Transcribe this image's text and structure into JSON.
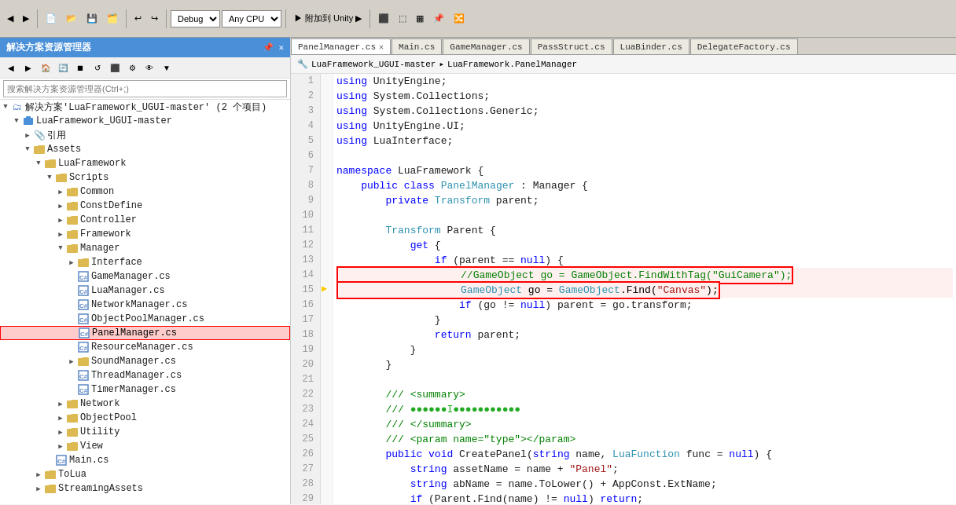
{
  "toolbar": {
    "debug_label": "Debug",
    "cpu_label": "Any CPU",
    "attach_label": "附加到 Unity ▶",
    "title": "解决方案资源管理器"
  },
  "tabs": [
    {
      "label": "PanelManager.cs",
      "active": true,
      "closable": true
    },
    {
      "label": "Main.cs",
      "active": false,
      "closable": false
    },
    {
      "label": "GameManager.cs",
      "active": false,
      "closable": false
    },
    {
      "label": "PassStruct.cs",
      "active": false,
      "closable": false
    },
    {
      "label": "LuaBinder.cs",
      "active": false,
      "closable": false
    },
    {
      "label": "DelegateFactory.cs",
      "active": false,
      "closable": false
    }
  ],
  "breadcrumb": {
    "project": "LuaFramework_UGUI-master",
    "class": "LuaFramework.PanelManager"
  },
  "tree": {
    "items": [
      {
        "id": "solution",
        "label": "解决方案'LuaFramework_UGUI-master' (2 个项目)",
        "indent": 0,
        "type": "solution",
        "expanded": true,
        "arrow": "▼"
      },
      {
        "id": "project",
        "label": "LuaFramework_UGUI-master",
        "indent": 1,
        "type": "project",
        "expanded": true,
        "arrow": "▼"
      },
      {
        "id": "ref",
        "label": "引用",
        "indent": 2,
        "type": "ref",
        "expanded": false,
        "arrow": "▶"
      },
      {
        "id": "assets",
        "label": "Assets",
        "indent": 2,
        "type": "folder",
        "expanded": true,
        "arrow": "▼"
      },
      {
        "id": "luaframework",
        "label": "LuaFramework",
        "indent": 3,
        "type": "folder",
        "expanded": true,
        "arrow": "▼"
      },
      {
        "id": "scripts",
        "label": "Scripts",
        "indent": 4,
        "type": "folder",
        "expanded": true,
        "arrow": "▼"
      },
      {
        "id": "common",
        "label": "Common",
        "indent": 5,
        "type": "folder",
        "expanded": false,
        "arrow": "▶"
      },
      {
        "id": "constdefine",
        "label": "ConstDefine",
        "indent": 5,
        "type": "folder",
        "expanded": false,
        "arrow": "▶"
      },
      {
        "id": "controller",
        "label": "Controller",
        "indent": 5,
        "type": "folder",
        "expanded": false,
        "arrow": "▶"
      },
      {
        "id": "framework",
        "label": "Framework",
        "indent": 5,
        "type": "folder",
        "expanded": false,
        "arrow": "▶"
      },
      {
        "id": "manager",
        "label": "Manager",
        "indent": 5,
        "type": "folder",
        "expanded": true,
        "arrow": "▼"
      },
      {
        "id": "interface",
        "label": "Interface",
        "indent": 6,
        "type": "folder",
        "expanded": false,
        "arrow": "▶"
      },
      {
        "id": "gamemanager",
        "label": "GameManager.cs",
        "indent": 6,
        "type": "cs"
      },
      {
        "id": "luamanager",
        "label": "LuaManager.cs",
        "indent": 6,
        "type": "cs"
      },
      {
        "id": "networkmanager",
        "label": "NetworkManager.cs",
        "indent": 6,
        "type": "cs"
      },
      {
        "id": "objectpoolmanager",
        "label": "ObjectPoolManager.cs",
        "indent": 6,
        "type": "cs"
      },
      {
        "id": "panelmanager",
        "label": "PanelManager.cs",
        "indent": 6,
        "type": "cs",
        "selected": true,
        "highlighted": true
      },
      {
        "id": "resourcemanager",
        "label": "ResourceManager.cs",
        "indent": 6,
        "type": "cs"
      },
      {
        "id": "soundmanager",
        "label": "SoundManager.cs",
        "indent": 6,
        "type": "folder",
        "expanded": false,
        "arrow": "▶"
      },
      {
        "id": "threadmanager",
        "label": "ThreadManager.cs",
        "indent": 6,
        "type": "cs"
      },
      {
        "id": "timermanager",
        "label": "TimerManager.cs",
        "indent": 6,
        "type": "cs"
      },
      {
        "id": "network",
        "label": "Network",
        "indent": 5,
        "type": "folder",
        "expanded": false,
        "arrow": "▶"
      },
      {
        "id": "objectpool",
        "label": "ObjectPool",
        "indent": 5,
        "type": "folder",
        "expanded": false,
        "arrow": "▶"
      },
      {
        "id": "utility",
        "label": "Utility",
        "indent": 5,
        "type": "folder",
        "expanded": false,
        "arrow": "▶"
      },
      {
        "id": "view",
        "label": "View",
        "indent": 5,
        "type": "folder",
        "expanded": false,
        "arrow": "▶"
      },
      {
        "id": "maincs",
        "label": "Main.cs",
        "indent": 4,
        "type": "cs"
      },
      {
        "id": "tolua",
        "label": "ToLua",
        "indent": 3,
        "type": "folder",
        "expanded": false,
        "arrow": "▶"
      },
      {
        "id": "streamingassets",
        "label": "StreamingAssets",
        "indent": 3,
        "type": "folder",
        "expanded": false,
        "arrow": "▶"
      }
    ]
  },
  "code": {
    "lines": [
      {
        "n": 1,
        "tokens": [
          {
            "t": "kw",
            "v": "using"
          },
          {
            "t": "plain",
            "v": " UnityEngine;"
          }
        ]
      },
      {
        "n": 2,
        "tokens": [
          {
            "t": "kw",
            "v": "using"
          },
          {
            "t": "plain",
            "v": " System.Collections;"
          }
        ]
      },
      {
        "n": 3,
        "tokens": [
          {
            "t": "kw",
            "v": "using"
          },
          {
            "t": "plain",
            "v": " System.Collections.Generic;"
          }
        ]
      },
      {
        "n": 4,
        "tokens": [
          {
            "t": "kw",
            "v": "using"
          },
          {
            "t": "plain",
            "v": " UnityEngine.UI;"
          }
        ]
      },
      {
        "n": 5,
        "tokens": [
          {
            "t": "kw",
            "v": "using"
          },
          {
            "t": "plain",
            "v": " LuaInterface;"
          }
        ]
      },
      {
        "n": 6,
        "tokens": []
      },
      {
        "n": 7,
        "tokens": [
          {
            "t": "kw",
            "v": "namespace"
          },
          {
            "t": "plain",
            "v": " LuaFramework {"
          }
        ]
      },
      {
        "n": 8,
        "tokens": [
          {
            "t": "plain",
            "v": "    "
          },
          {
            "t": "kw",
            "v": "public"
          },
          {
            "t": "plain",
            "v": " "
          },
          {
            "t": "kw",
            "v": "class"
          },
          {
            "t": "plain",
            "v": " "
          },
          {
            "t": "type",
            "v": "PanelManager"
          },
          {
            "t": "plain",
            "v": " : Manager {"
          }
        ]
      },
      {
        "n": 9,
        "tokens": [
          {
            "t": "plain",
            "v": "        "
          },
          {
            "t": "kw",
            "v": "private"
          },
          {
            "t": "plain",
            "v": " "
          },
          {
            "t": "type",
            "v": "Transform"
          },
          {
            "t": "plain",
            "v": " parent;"
          }
        ]
      },
      {
        "n": 10,
        "tokens": []
      },
      {
        "n": 11,
        "tokens": [
          {
            "t": "plain",
            "v": "        "
          },
          {
            "t": "type",
            "v": "Transform"
          },
          {
            "t": "plain",
            "v": " Parent {"
          }
        ]
      },
      {
        "n": 12,
        "tokens": [
          {
            "t": "plain",
            "v": "            "
          },
          {
            "t": "kw",
            "v": "get"
          },
          {
            "t": "plain",
            "v": " {"
          }
        ]
      },
      {
        "n": 13,
        "tokens": [
          {
            "t": "plain",
            "v": "                "
          },
          {
            "t": "kw",
            "v": "if"
          },
          {
            "t": "plain",
            "v": " (parent == "
          },
          {
            "t": "kw",
            "v": "null"
          },
          {
            "t": "plain",
            "v": ") {"
          }
        ]
      },
      {
        "n": 14,
        "tokens": [
          {
            "t": "comment",
            "v": "                    //GameObject go = GameObject.FindWithTag(\"GuiCamera\");"
          }
        ],
        "redbox": true
      },
      {
        "n": 15,
        "tokens": [
          {
            "t": "plain",
            "v": "                    "
          },
          {
            "t": "type",
            "v": "GameObject"
          },
          {
            "t": "plain",
            "v": " go = "
          },
          {
            "t": "type",
            "v": "GameObject"
          },
          {
            "t": "plain",
            "v": ".Find("
          },
          {
            "t": "string",
            "v": "\"Canvas\""
          },
          {
            "t": "plain",
            "v": ");"
          },
          {
            "t": "plain",
            "v": ""
          }
        ],
        "redbox": true,
        "execpointer": true
      },
      {
        "n": 16,
        "tokens": [
          {
            "t": "plain",
            "v": "                    "
          },
          {
            "t": "kw",
            "v": "if"
          },
          {
            "t": "plain",
            "v": " (go != "
          },
          {
            "t": "kw",
            "v": "null"
          },
          {
            "t": "plain",
            "v": ") parent = go.transform;"
          }
        ]
      },
      {
        "n": 17,
        "tokens": [
          {
            "t": "plain",
            "v": "                }"
          }
        ]
      },
      {
        "n": 18,
        "tokens": [
          {
            "t": "plain",
            "v": "                "
          },
          {
            "t": "kw",
            "v": "return"
          },
          {
            "t": "plain",
            "v": " parent;"
          }
        ]
      },
      {
        "n": 19,
        "tokens": [
          {
            "t": "plain",
            "v": "            }"
          }
        ]
      },
      {
        "n": 20,
        "tokens": [
          {
            "t": "plain",
            "v": "        }"
          }
        ]
      },
      {
        "n": 21,
        "tokens": []
      },
      {
        "n": 22,
        "tokens": [
          {
            "t": "plain",
            "v": "        "
          },
          {
            "t": "comment",
            "v": "/// <summary>"
          }
        ]
      },
      {
        "n": 23,
        "tokens": [
          {
            "t": "plain",
            "v": "        "
          },
          {
            "t": "comment",
            "v": "/// "
          },
          {
            "t": "green-dots",
            "v": "●●●●●●I●●●●●●●●●●●"
          }
        ]
      },
      {
        "n": 24,
        "tokens": [
          {
            "t": "plain",
            "v": "        "
          },
          {
            "t": "comment",
            "v": "/// </summary>"
          }
        ]
      },
      {
        "n": 25,
        "tokens": [
          {
            "t": "plain",
            "v": "        "
          },
          {
            "t": "comment",
            "v": "/// <param name=\"type\"></param>"
          }
        ]
      },
      {
        "n": 26,
        "tokens": [
          {
            "t": "plain",
            "v": "        "
          },
          {
            "t": "kw",
            "v": "public"
          },
          {
            "t": "plain",
            "v": " "
          },
          {
            "t": "kw",
            "v": "void"
          },
          {
            "t": "plain",
            "v": " CreatePanel("
          },
          {
            "t": "kw",
            "v": "string"
          },
          {
            "t": "plain",
            "v": " name, "
          },
          {
            "t": "type",
            "v": "LuaFunction"
          },
          {
            "t": "plain",
            "v": " func = "
          },
          {
            "t": "kw",
            "v": "null"
          },
          {
            "t": "plain",
            "v": ") {"
          }
        ]
      },
      {
        "n": 27,
        "tokens": [
          {
            "t": "plain",
            "v": "            "
          },
          {
            "t": "kw",
            "v": "string"
          },
          {
            "t": "plain",
            "v": " assetName = name + "
          },
          {
            "t": "string",
            "v": "\"Panel\""
          },
          {
            "t": "plain",
            "v": ";"
          }
        ]
      },
      {
        "n": 28,
        "tokens": [
          {
            "t": "plain",
            "v": "            "
          },
          {
            "t": "kw",
            "v": "string"
          },
          {
            "t": "plain",
            "v": " abName = name.ToLower() + AppConst.ExtName;"
          }
        ]
      },
      {
        "n": 29,
        "tokens": [
          {
            "t": "plain",
            "v": "            "
          },
          {
            "t": "kw",
            "v": "if"
          },
          {
            "t": "plain",
            "v": " (Parent.Find(name) != "
          },
          {
            "t": "kw",
            "v": "null"
          },
          {
            "t": "plain",
            "v": ") "
          },
          {
            "t": "kw",
            "v": "return"
          },
          {
            "t": "plain",
            "v": ";"
          }
        ]
      }
    ]
  },
  "search_placeholder": "搜索解决方案资源管理器(Ctrl+;)"
}
